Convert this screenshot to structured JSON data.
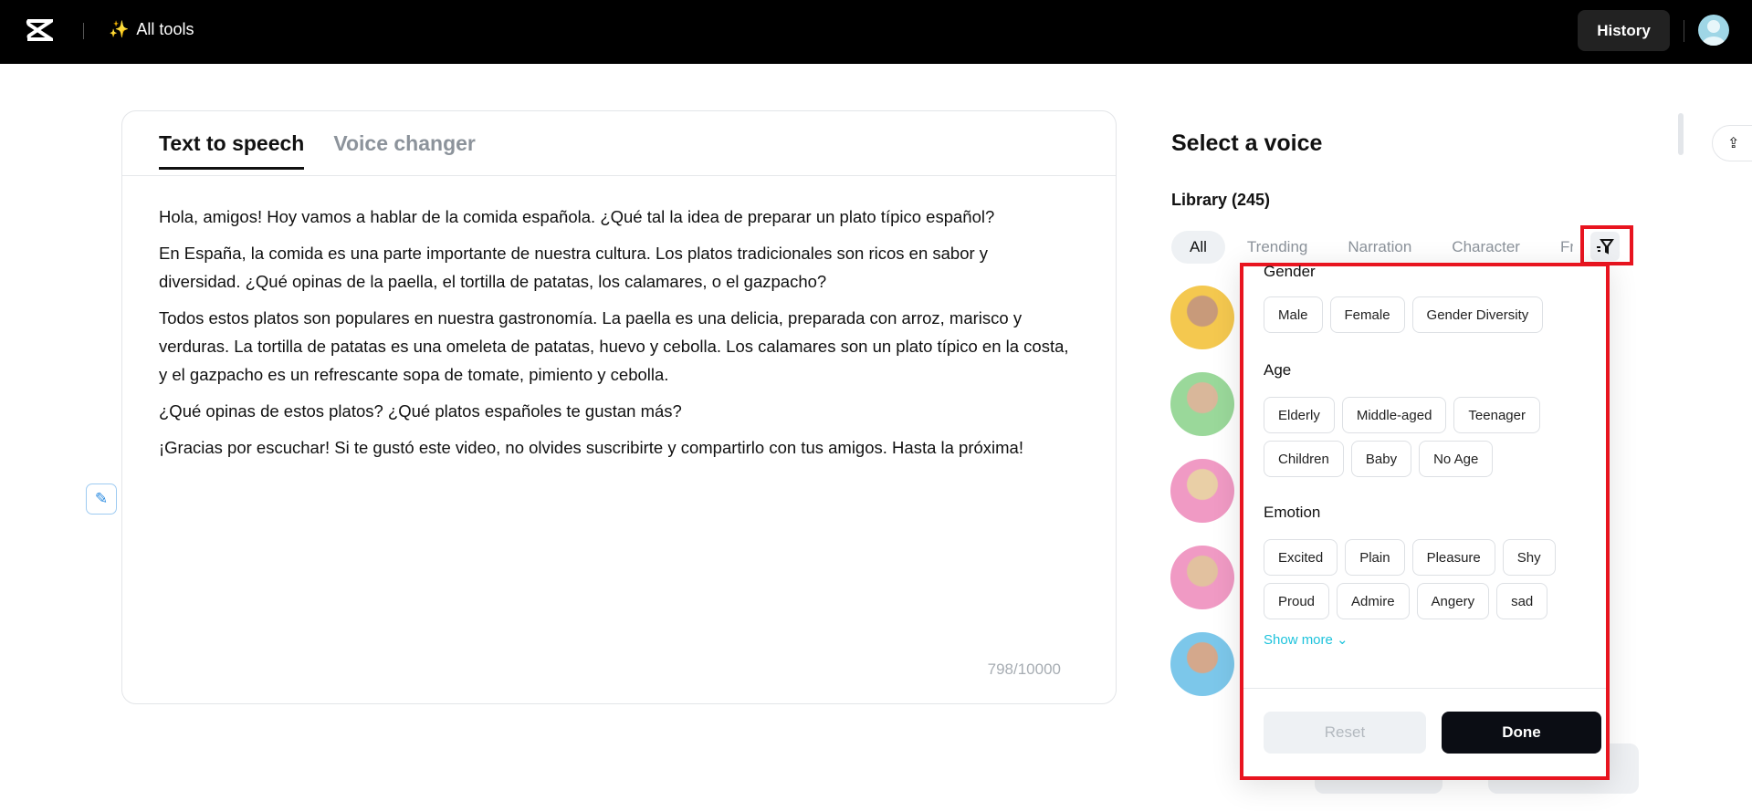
{
  "header": {
    "all_tools": "All tools",
    "history": "History"
  },
  "tabs": [
    {
      "label": "Text to speech"
    },
    {
      "label": "Voice changer"
    }
  ],
  "editor": {
    "paragraphs": [
      "Hola, amigos! Hoy vamos a hablar de la comida española. ¿Qué tal la idea de preparar un plato típico español?",
      "En España, la comida es una parte importante de nuestra cultura. Los platos tradicionales son ricos en sabor y diversidad. ¿Qué opinas de la paella, el tortilla de patatas, los calamares, o el gazpacho?",
      "Todos estos platos son populares en nuestra gastronomía. La paella es una delicia, preparada con arroz, marisco y verduras. La tortilla de patatas es una omeleta de patatas, huevo y cebolla. Los calamares son un plato típico en la costa, y el gazpacho es un refrescante sopa de tomate, pimiento y cebolla.",
      "¿Qué opinas de estos platos? ¿Qué platos españoles te gustan más?",
      "¡Gracias por escuchar! Si te gustó este video, no olvides suscribirte y compartirlo con tus amigos. Hasta la próxima!"
    ],
    "counter": "798/10000"
  },
  "voice_panel": {
    "title": "Select a voice",
    "library": "Library (245)",
    "categories": [
      "All",
      "Trending",
      "Narration",
      "Character",
      "Fre"
    ]
  },
  "filter": {
    "gender_label": "Gender",
    "gender": [
      "Male",
      "Female",
      "Gender Diversity"
    ],
    "age_label": "Age",
    "age": [
      "Elderly",
      "Middle-aged",
      "Teenager",
      "Children",
      "Baby",
      "No Age"
    ],
    "emotion_label": "Emotion",
    "emotion": [
      "Excited",
      "Plain",
      "Pleasure",
      "Shy",
      "Proud",
      "Admire",
      "Angery",
      "sad"
    ],
    "show_more": "Show more",
    "reset": "Reset",
    "done": "Done"
  },
  "colors": {
    "accent": "#1ec3dc",
    "highlight": "#e8141f"
  }
}
